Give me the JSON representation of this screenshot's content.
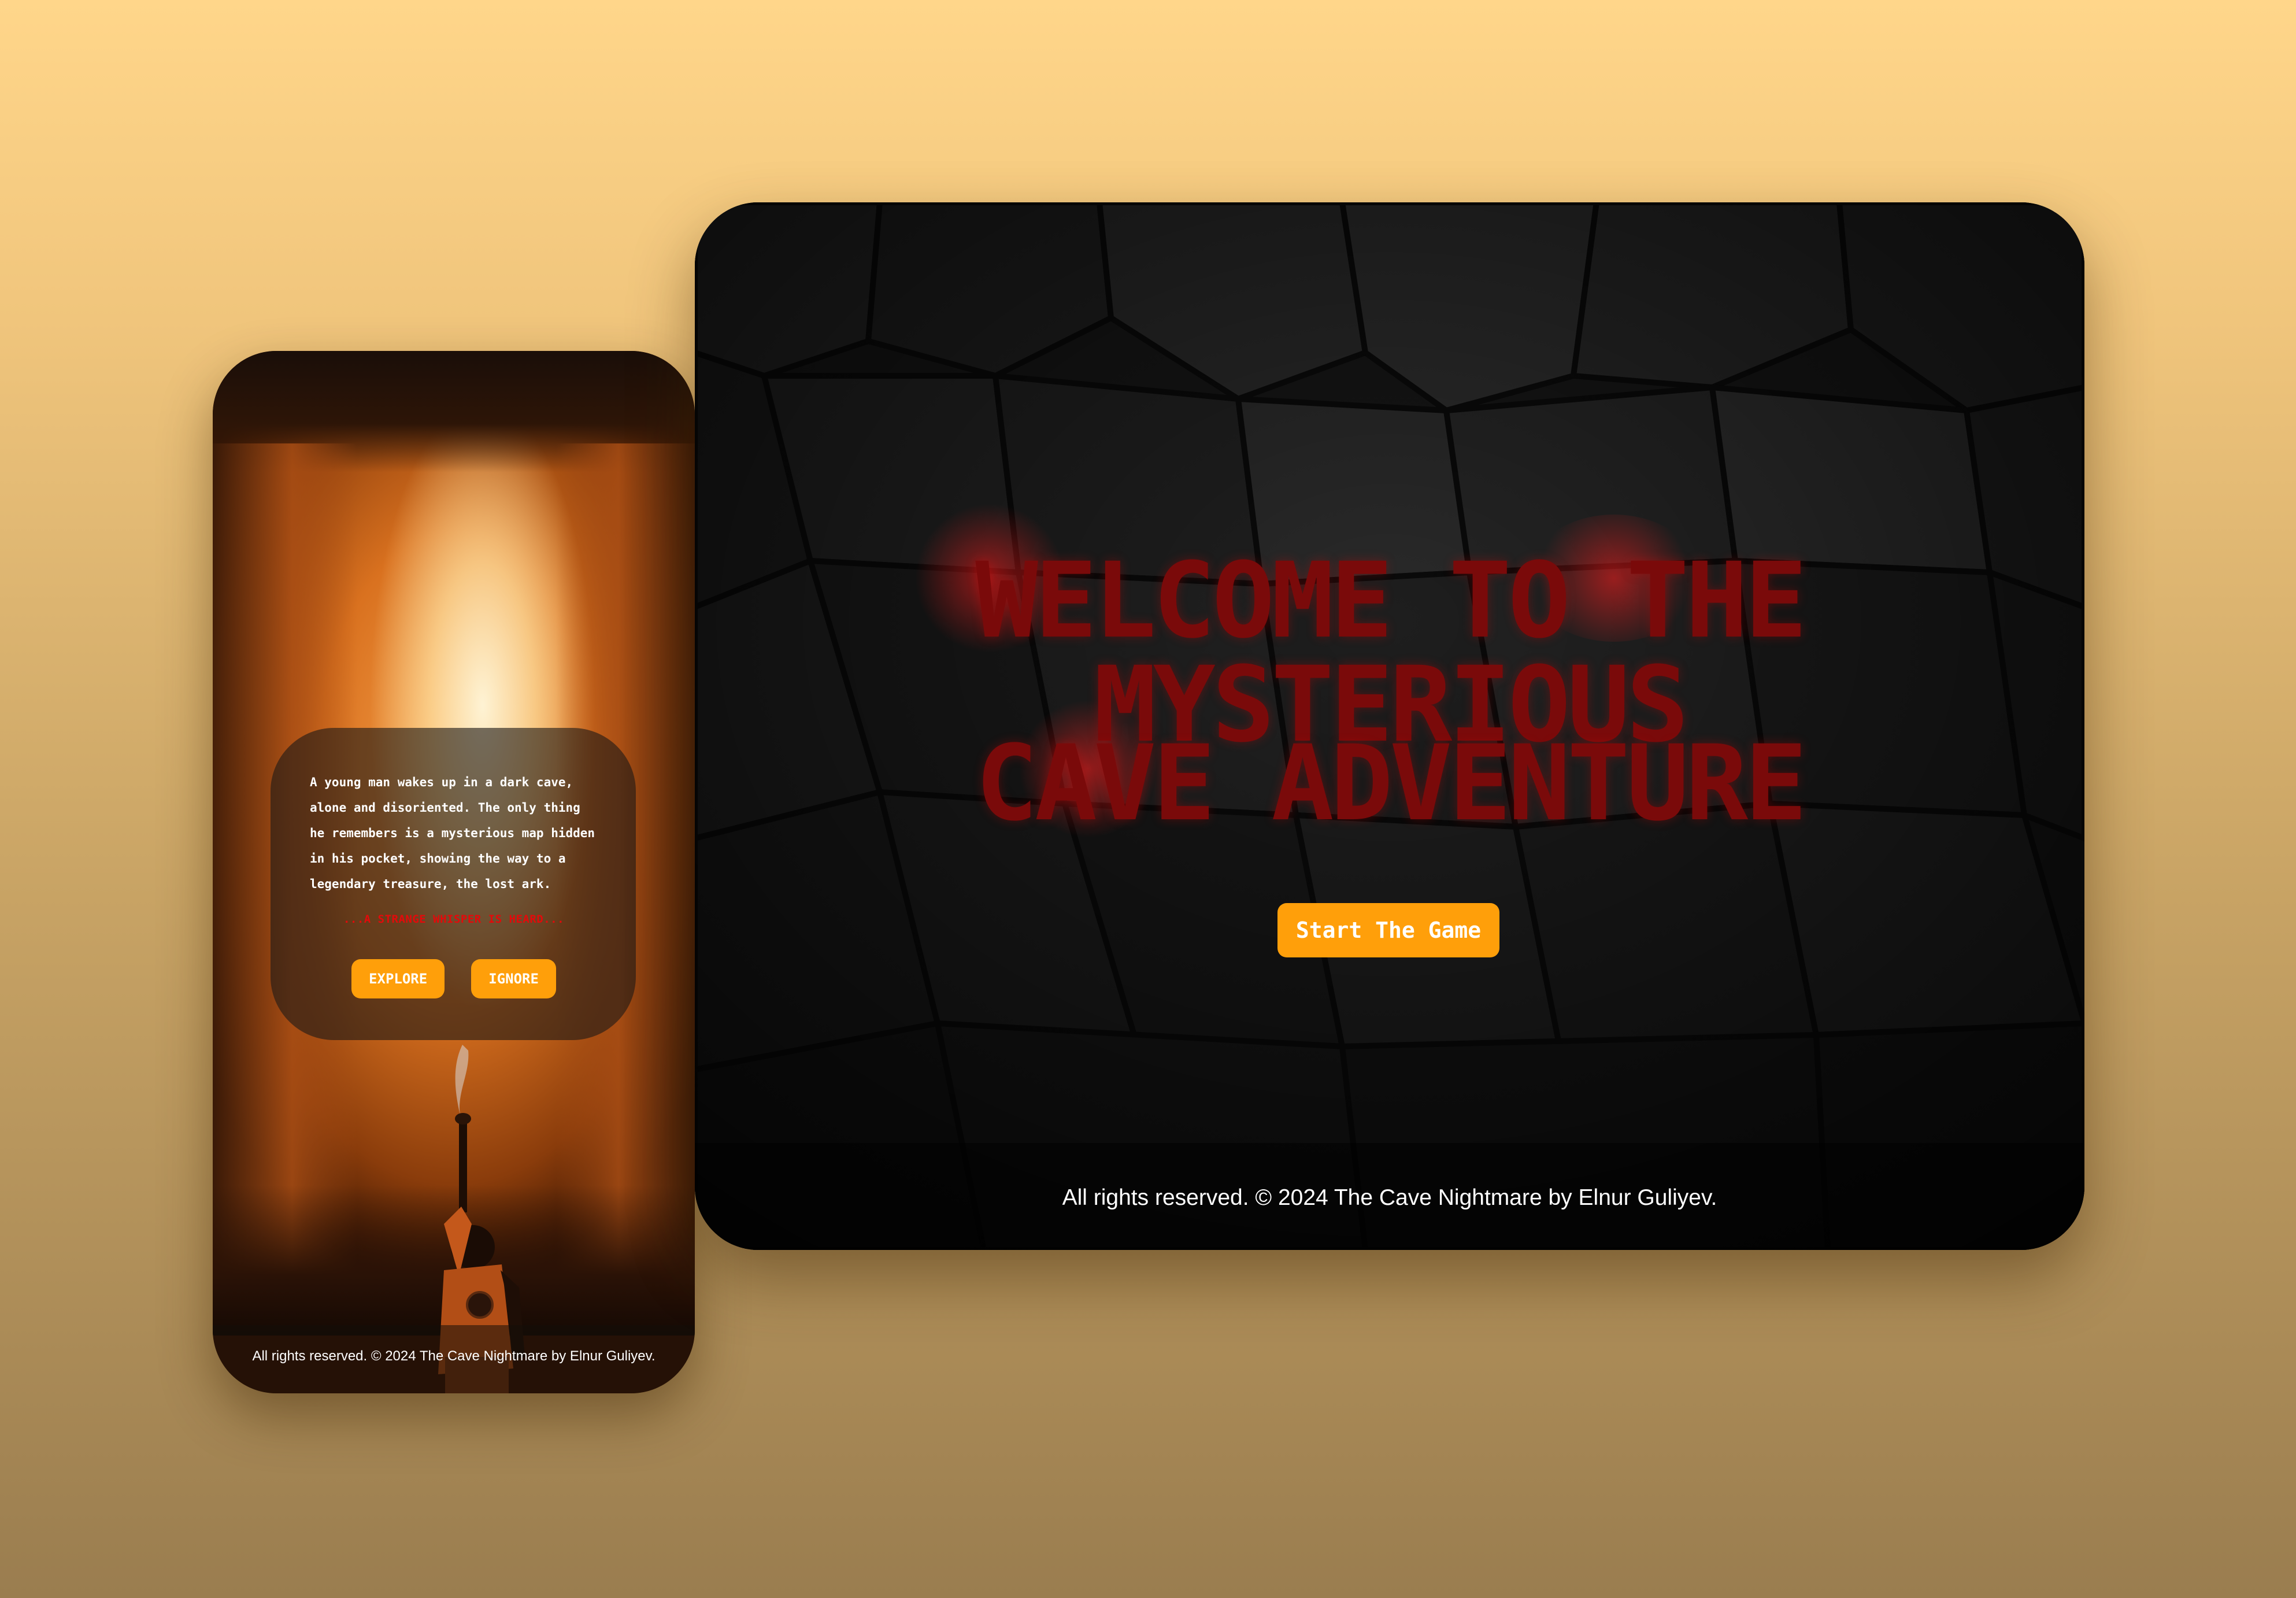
{
  "mobile": {
    "story_text": "A young man wakes up in a dark cave, alone and disoriented. The only thing he remembers is a mysterious map hidden in his pocket, showing the way to a legendary treasure, the lost ark.",
    "whisper_text": "...A STRANGE WHISPER IS HEARD...",
    "explore_label": "EXPLORE",
    "ignore_label": "IGNORE",
    "footer_text": "All rights reserved. © 2024 The Cave Nightmare by Elnur Guliyev."
  },
  "desktop": {
    "title_line_1": "WELCOME TO THE MYSTERIOUS",
    "title_line_2": "CAVE ADVENTURE",
    "start_label": "Start The Game",
    "footer_text": "All rights reserved. © 2024 The Cave Nightmare by Elnur Guliyev."
  },
  "colors": {
    "background_top": "#ffd68a",
    "background_bottom": "#9a7d4f",
    "button_accent": "#ff9f0a",
    "title_red": "#7a0a0a",
    "whisper_red": "#e30a0a"
  }
}
